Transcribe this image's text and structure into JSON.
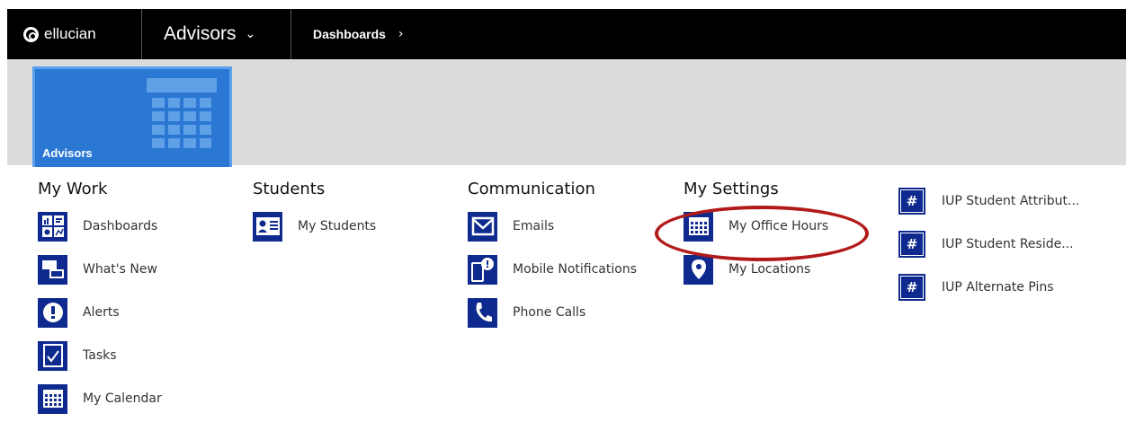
{
  "topbar": {
    "logo_text": "ellucian",
    "app_title": "Advisors",
    "caret": "⌄",
    "breadcrumb": "Dashboards",
    "breadcrumb_chevron": "›"
  },
  "tile": {
    "label": "Advisors"
  },
  "columns": {
    "my_work": {
      "heading": "My Work",
      "items": [
        {
          "label": "Dashboards",
          "icon": "dashboard-icon"
        },
        {
          "label": "What's New",
          "icon": "chat-icon"
        },
        {
          "label": "Alerts",
          "icon": "alert-icon"
        },
        {
          "label": "Tasks",
          "icon": "task-check-icon"
        },
        {
          "label": "My Calendar",
          "icon": "calendar-icon"
        }
      ]
    },
    "students": {
      "heading": "Students",
      "items": [
        {
          "label": "My Students",
          "icon": "student-card-icon"
        }
      ]
    },
    "communication": {
      "heading": "Communication",
      "items": [
        {
          "label": "Emails",
          "icon": "envelope-icon"
        },
        {
          "label": "Mobile Notifications",
          "icon": "mobile-notification-icon"
        },
        {
          "label": "Phone Calls",
          "icon": "phone-icon"
        }
      ]
    },
    "my_settings": {
      "heading": "My Settings",
      "items": [
        {
          "label": "My Office Hours",
          "icon": "calendar-icon"
        },
        {
          "label": "My Locations",
          "icon": "location-pin-icon"
        }
      ]
    },
    "iup": {
      "items": [
        {
          "label": "IUP Student Attribut...",
          "icon": "hash-icon"
        },
        {
          "label": "IUP Student Reside...",
          "icon": "hash-icon"
        },
        {
          "label": "IUP Alternate Pins",
          "icon": "hash-icon"
        }
      ]
    }
  },
  "colors": {
    "topbar_bg": "#000000",
    "tile_bg": "#2b78d4",
    "icon_bg": "#0f2a8f",
    "highlight": "#b21a1a"
  }
}
